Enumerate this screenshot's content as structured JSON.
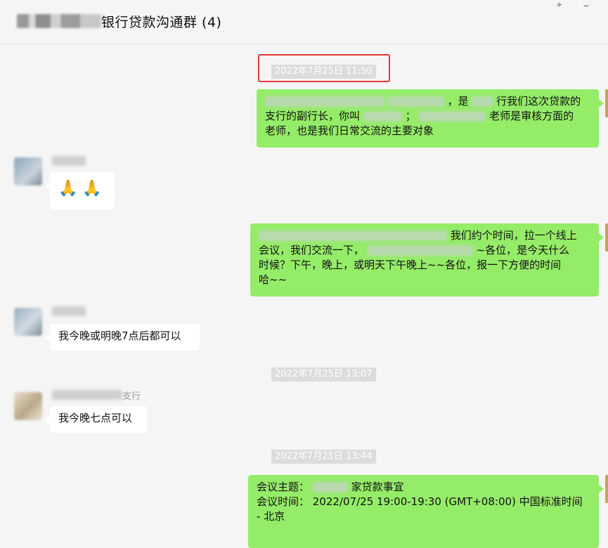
{
  "window": {
    "title": "银行贷款沟通群 (4)",
    "pin_icon": "pin-icon",
    "minimize_icon": "minimize-icon"
  },
  "messages": {
    "ts1": "2022年7月25日 11:50",
    "m1_p1": "，是",
    "m1_p2": "行我们这次贷款的",
    "m1_p3": "支行的副行长，你叫",
    "m1_p4": "；",
    "m1_p5": "老师是审核方面的",
    "m1_p6": "老师，也是我们日常交流的主要对象",
    "m2_emoji": "🙏 🙏",
    "m3_p1": "我们约个时间，拉一个线上",
    "m3_p2": "会议，我们交流一下，",
    "m3_p3": "~各位，是今天什么",
    "m3_p4": "时候？下午，晚上，或明天下午晚上~~各位，报一下方便的时间",
    "m3_p5": "哈~~",
    "m4": "我今晚或明晚7点后都可以",
    "ts2": "2022年7月25日 13:07",
    "sender5_suffix": "支行",
    "m5": "我今晚七点可以",
    "ts3": "2022年7月25日 13:44",
    "m6_label1": "会议主题：",
    "m6_value1": "家贷款事宜",
    "m6_label2": "会议时间：",
    "m6_value2": "2022/07/25 19:00-19:30 (GMT+08:00) 中国标准时间",
    "m6_value3": "- 北京"
  },
  "colors": {
    "self_bubble": "#95ec69",
    "other_bubble": "#ffffff",
    "highlight_border": "#e53935",
    "timestamp_bg": "#dcdcdc"
  }
}
